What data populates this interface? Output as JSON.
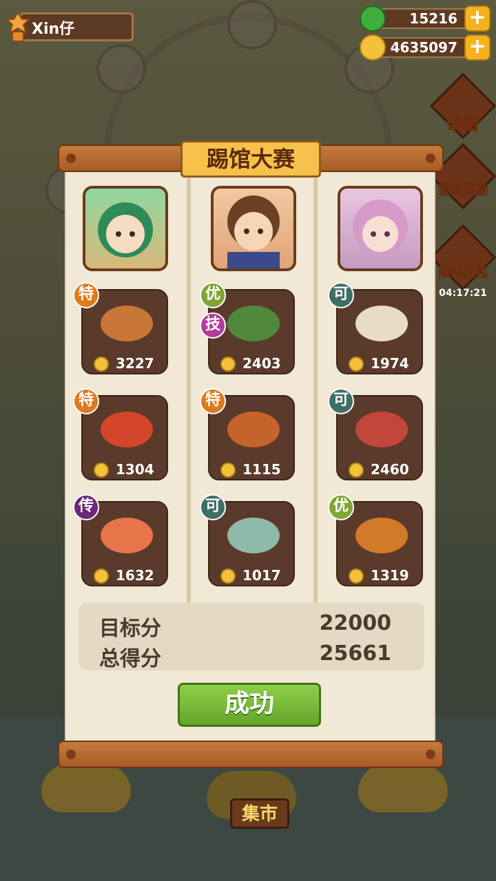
{
  "player": {
    "name": "Xin仔"
  },
  "resources": [
    {
      "icon": "jade-icon",
      "value": "15216"
    },
    {
      "icon": "coin-icon",
      "value": "4635097"
    }
  ],
  "side_events": [
    {
      "label": "公告",
      "icon": "notice-icon"
    },
    {
      "label": "签到奖励",
      "icon": "checkin-chest-icon"
    },
    {
      "label": "限时礼包",
      "icon": "gift-box-icon",
      "timer": "04:17:21"
    }
  ],
  "market_label": "集市",
  "panel": {
    "title": "踢馆大赛",
    "columns": [
      {
        "avatar": "green-hair-girl-portrait",
        "dishes": [
          {
            "grade": "特",
            "score": "3227",
            "icon": "stew-pot-dish-icon"
          },
          {
            "grade": "特",
            "score": "1304",
            "icon": "crayfish-dish-icon"
          },
          {
            "grade": "传",
            "score": "1632",
            "icon": "soup-bowl-dish-icon"
          }
        ]
      },
      {
        "avatar": "brown-hair-boy-portrait",
        "dishes": [
          {
            "grade": "优",
            "skill": "技",
            "score": "2403",
            "icon": "bento-dish-icon"
          },
          {
            "grade": "特",
            "score": "1115",
            "icon": "noodle-bowl-dish-icon"
          },
          {
            "grade": "可",
            "score": "1017",
            "icon": "tea-set-dish-icon"
          }
        ]
      },
      {
        "avatar": "pink-hair-girl-portrait",
        "dishes": [
          {
            "grade": "可",
            "score": "1974",
            "icon": "layer-cake-dish-icon"
          },
          {
            "grade": "可",
            "score": "2460",
            "icon": "hotpot-dish-icon"
          },
          {
            "grade": "优",
            "score": "1319",
            "icon": "steamer-dish-icon"
          }
        ]
      }
    ],
    "target_label": "目标分",
    "target_value": "22000",
    "total_label": "总得分",
    "total_value": "25661",
    "result_button": "成功"
  },
  "colors": {
    "grade_特": "#e07a1e",
    "grade_优": "#7fa533",
    "grade_可": "#3e6f66",
    "grade_传": "#6a2a7a",
    "skill_技": "#b43a9e",
    "panel_paper": "#f1e8d5",
    "dish_card": "#5a3a2a",
    "success_button": "#7abd3a"
  }
}
